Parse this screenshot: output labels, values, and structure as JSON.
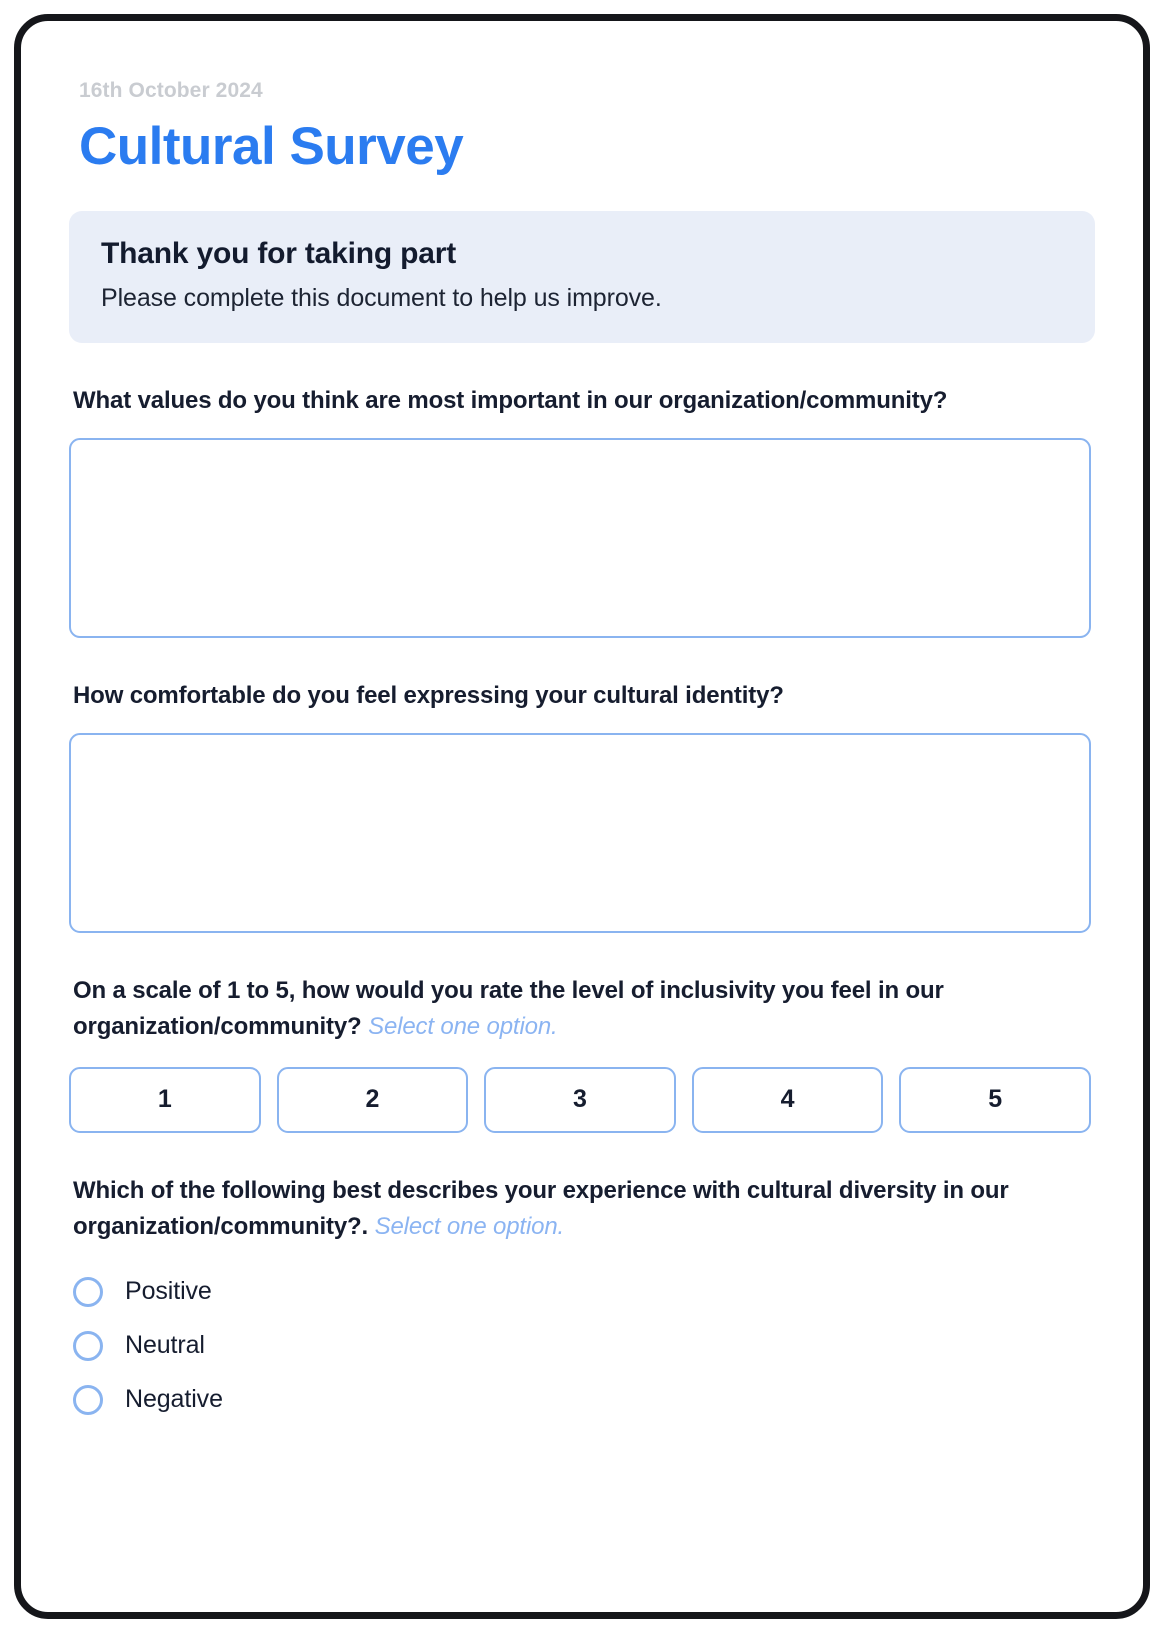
{
  "document": {
    "date": "16th October 2024",
    "title": "Cultural Survey"
  },
  "banner": {
    "title": "Thank you for taking part",
    "subtitle": "Please complete this document to help us improve."
  },
  "questions": [
    {
      "label": "What values do you think are most important in our organization/community?",
      "type": "textarea",
      "value": "",
      "placeholder": ""
    },
    {
      "label": "How comfortable do you feel expressing your cultural identity?",
      "type": "textarea",
      "value": "",
      "placeholder": ""
    },
    {
      "label": "On a scale of 1 to 5, how would you rate the level of inclusivity you feel in our organization/community?",
      "hint": "Select one option.",
      "type": "scale",
      "options": [
        "1",
        "2",
        "3",
        "4",
        "5"
      ]
    },
    {
      "label": "Which of the following best describes your experience with cultural diversity in our organization/community?.",
      "hint": "Select one option.",
      "type": "radio",
      "options": [
        "Positive",
        "Neutral",
        "Negative"
      ]
    }
  ],
  "colors": {
    "accent": "#2b7cf0",
    "border_blue": "#8ab4f0",
    "banner_bg": "#e9eef8",
    "text_dark": "#161d2f",
    "date_gray": "#c9ccd1",
    "frame": "#15161a"
  }
}
